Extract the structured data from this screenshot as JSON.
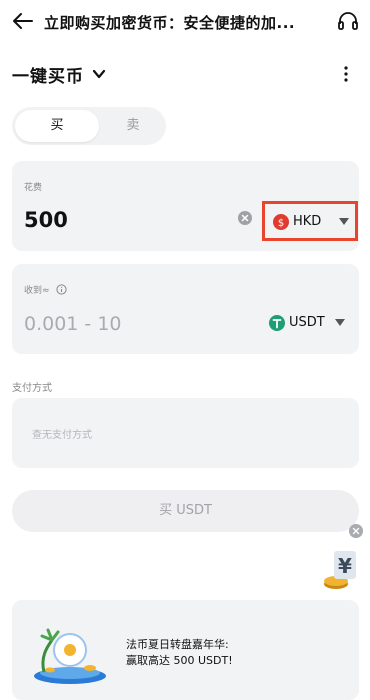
{
  "header": {
    "title": "立即购买加密货币：安全便捷的加...",
    "back_icon": "arrow-left-icon",
    "support_icon": "headset-icon"
  },
  "mode": {
    "title": "一键买币"
  },
  "tabs": {
    "buy_label": "买",
    "sell_label": "卖"
  },
  "spend": {
    "label": "花费",
    "amount": "500",
    "currency": "HKD",
    "currency_color": "#e8452c"
  },
  "receive": {
    "label": "收到≈",
    "range": "0.001 - 10",
    "currency": "USDT",
    "currency_color": "#1f9d73"
  },
  "payment": {
    "label": "支付方式",
    "placeholder": "查无支付方式"
  },
  "buy_button": {
    "label": "买 USDT"
  },
  "promo": {
    "line1": "法币夏日转盘嘉年华:",
    "line2": "赢取高达 500 USDT!"
  },
  "colors": {
    "highlight_border": "#e8452c",
    "card_bg": "#f2f3f5"
  }
}
